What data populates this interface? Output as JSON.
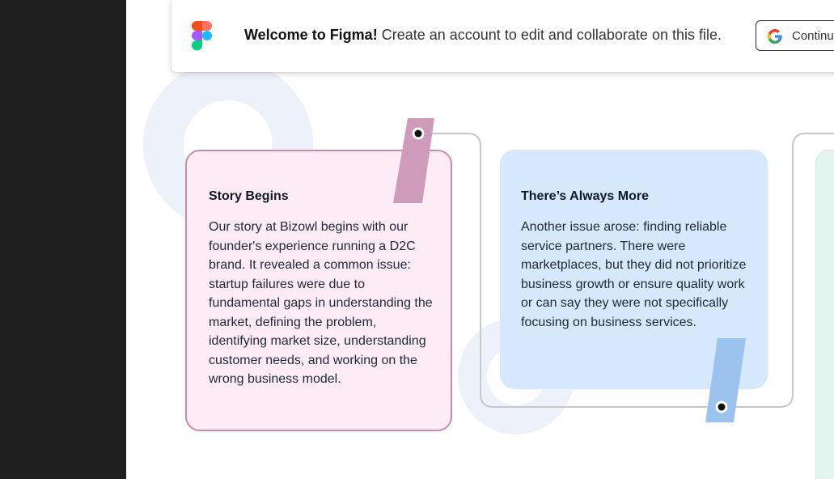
{
  "banner": {
    "welcome": "Welcome to Figma!",
    "message": "Create an account to edit and collaborate on this file.",
    "continue_label": "Continue with Google"
  },
  "icons": {
    "figma_logo": "figma-logo-icon",
    "google": "google-g-icon"
  },
  "cards": [
    {
      "title": "Story Begins",
      "body": "Our story at Bizowl begins with our founder's experience running a D2C brand. It revealed a common issue: startup failures were due to fundamental gaps in understanding the market, defining the problem, identifying market size, understanding customer needs, and working on the wrong business model."
    },
    {
      "title": "There’s Always More",
      "body": "Another issue arose: finding reliable service partners. There were marketplaces, but they did not prioritize business growth or ensure quality work or can say they were not specifically focusing on business services."
    }
  ],
  "colors": {
    "card1_bg": "#fdebf5",
    "card1_border": "#c98aab",
    "card2_bg": "#d6e8fb",
    "tab_pink": "#cf9bbb",
    "tab_blue": "#9cc3ee",
    "connector": "#c8c8c8",
    "deco_circle": "#edf2fa",
    "card3_bg": "#e3f5ee"
  }
}
